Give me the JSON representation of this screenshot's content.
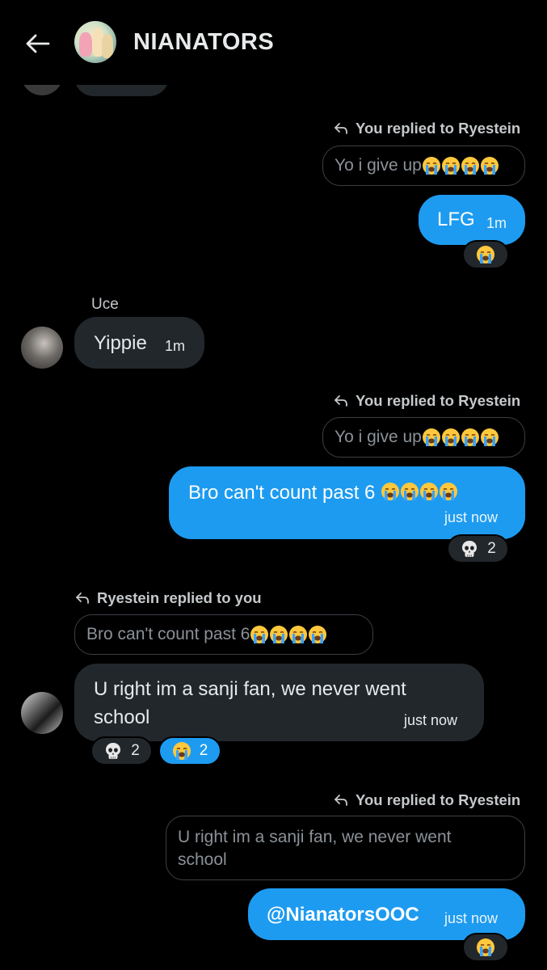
{
  "header": {
    "title": "NIANATORS",
    "back_icon": "arrow-left-icon",
    "avatar": "group-avatar"
  },
  "colors": {
    "accent": "#1d9bf0",
    "bubble_incoming": "#22272c",
    "background": "#000000"
  },
  "messages": {
    "m1": {
      "reply_label": "You replied to Ryestein",
      "quote": "Yo i give up",
      "quote_emoji_count": 4,
      "text": "LFG",
      "time": "1m",
      "reaction": {
        "icon": "loudly-crying-face-icon"
      }
    },
    "m2": {
      "sender": "Uce",
      "text": "Yippie",
      "time": "1m"
    },
    "m3": {
      "reply_label": "You replied to Ryestein",
      "quote": "Yo i give up",
      "quote_emoji_count": 4,
      "text": "Bro can't count past 6 ",
      "text_emoji_count": 4,
      "time": "just now",
      "reaction": {
        "icon": "skull-icon",
        "count": "2"
      }
    },
    "m4": {
      "reply_label": "Ryestein replied to you",
      "quote": "Bro can't count past 6 ",
      "quote_emoji_count": 4,
      "text_line1": "U right im a sanji fan, we never went",
      "text_line2": "school",
      "time": "just now",
      "reactions": [
        {
          "icon": "skull-icon",
          "count": "2"
        },
        {
          "icon": "loudly-crying-face-icon",
          "count": "2",
          "active": true
        }
      ]
    },
    "m5": {
      "reply_label": "You replied to Ryestein",
      "quote_line1": "U right im a sanji fan, we never went",
      "quote_line2": "school",
      "text": "@NianatorsOOC",
      "time": "just now",
      "reaction": {
        "icon": "loudly-crying-face-icon"
      }
    }
  }
}
